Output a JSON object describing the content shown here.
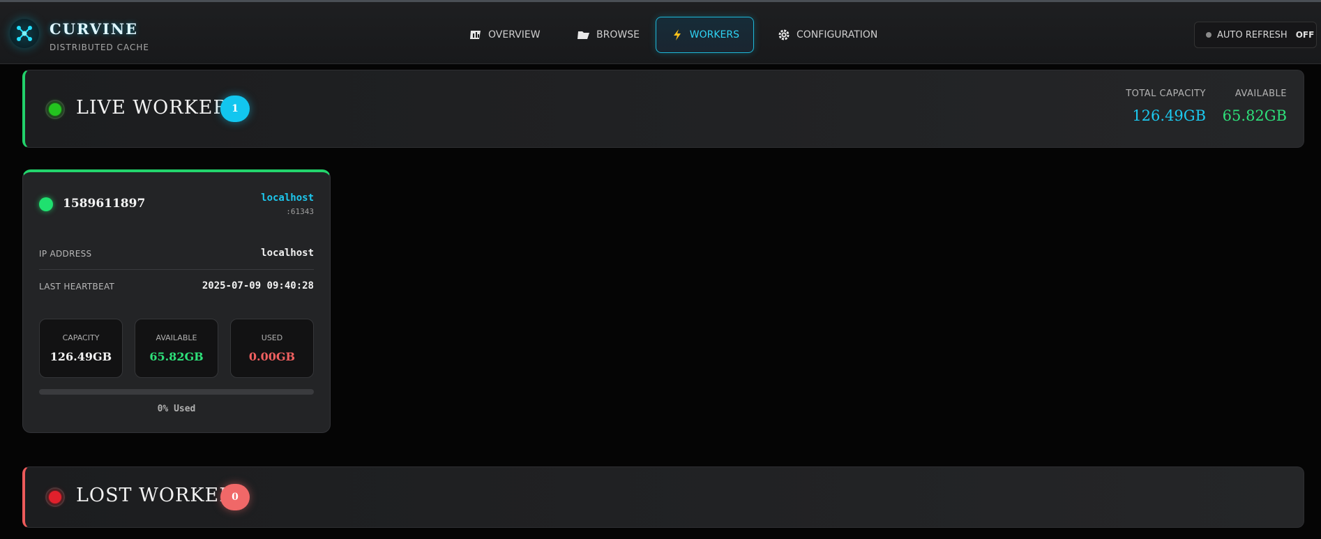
{
  "brand": {
    "title": "CURVINE",
    "subtitle": "DISTRIBUTED CACHE",
    "logo_icon": "network-node-icon"
  },
  "nav": {
    "items": [
      {
        "label": "OVERVIEW",
        "icon": "chart-bars-icon"
      },
      {
        "label": "BROWSE",
        "icon": "folder-icon"
      },
      {
        "label": "WORKERS",
        "icon": "lightning-icon",
        "active": true
      },
      {
        "label": "CONFIGURATION",
        "icon": "gear-icon"
      }
    ]
  },
  "auto_refresh": {
    "label": "AUTO REFRESH",
    "state": "OFF"
  },
  "live_workers": {
    "title": "LIVE WORKERS",
    "count": "1",
    "total_capacity_label": "TOTAL CAPACITY",
    "total_capacity_value": "126.49GB",
    "available_label": "AVAILABLE",
    "available_value": "65.82GB"
  },
  "workers": [
    {
      "id": "1589611897",
      "host": "localhost",
      "port": ":61343",
      "ip_label": "IP ADDRESS",
      "ip_value": "localhost",
      "heartbeat_label": "LAST HEARTBEAT",
      "heartbeat_value": "2025-07-09 09:40:28",
      "capacity_label": "CAPACITY",
      "capacity_value": "126.49GB",
      "available_label": "AVAILABLE",
      "available_value": "65.82GB",
      "used_label": "USED",
      "used_value": "0.00GB",
      "usage_percent": 0,
      "usage_text": "0% Used"
    }
  ],
  "lost_workers": {
    "title": "LOST WORKERS",
    "count": "0"
  },
  "colors": {
    "accent_cyan": "#1ccaf0",
    "live_green": "#23d46c",
    "lost_red": "#ec5a5a"
  }
}
